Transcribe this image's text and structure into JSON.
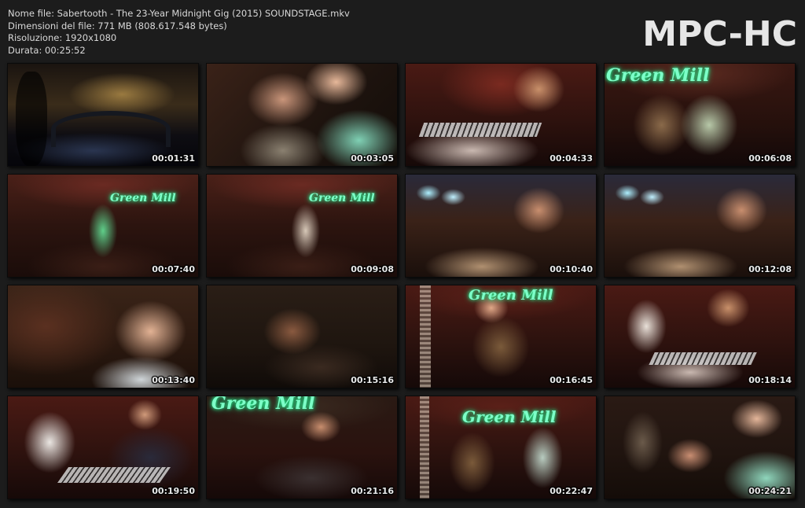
{
  "info": {
    "line1": "Nome file: Sabertooth - The 23-Year Midnight Gig (2015) SOUNDSTAGE.mkv",
    "line2": "Dimensioni del file: 771 MB (808.617.548 bytes)",
    "line3": "Risoluzione: 1920x1080",
    "line4": "Durata: 00:25:52"
  },
  "logo": "MPC-HC",
  "neon_text": "Green Mill",
  "thumbnails": [
    {
      "time": "00:01:31"
    },
    {
      "time": "00:03:05"
    },
    {
      "time": "00:04:33"
    },
    {
      "time": "00:06:08"
    },
    {
      "time": "00:07:40"
    },
    {
      "time": "00:09:08"
    },
    {
      "time": "00:10:40"
    },
    {
      "time": "00:12:08"
    },
    {
      "time": "00:13:40"
    },
    {
      "time": "00:15:16"
    },
    {
      "time": "00:16:45"
    },
    {
      "time": "00:18:14"
    },
    {
      "time": "00:19:50"
    },
    {
      "time": "00:21:16"
    },
    {
      "time": "00:22:47"
    },
    {
      "time": "00:24:21"
    }
  ]
}
